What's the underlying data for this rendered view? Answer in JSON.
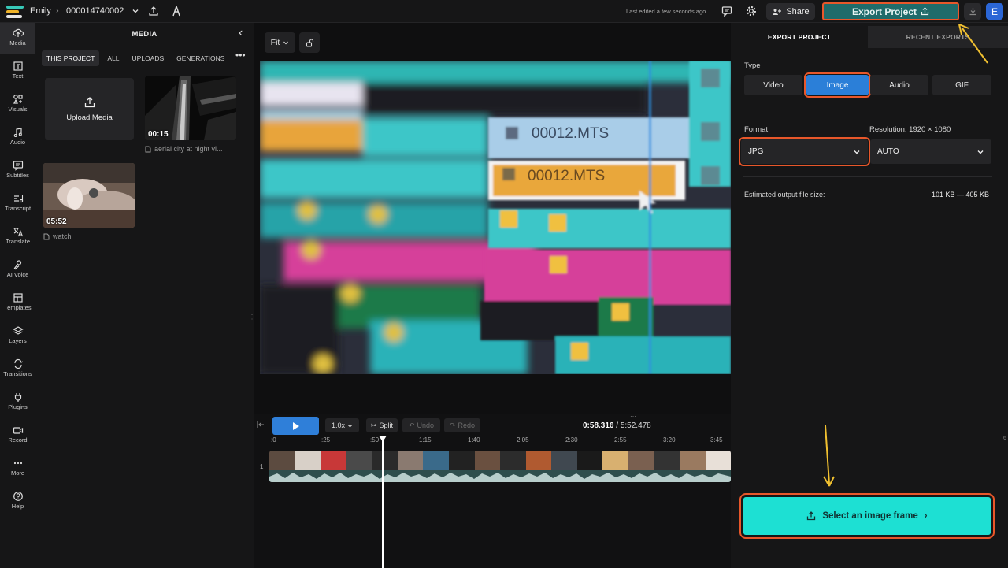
{
  "topbar": {
    "user_name": "Emily",
    "project_id": "000014740002",
    "last_edited": "Last edited a few seconds ago",
    "share_label": "Share",
    "export_label": "Export Project",
    "avatar_initial": "E"
  },
  "leftnav": {
    "items": [
      {
        "label": "Media",
        "icon": "upload-cloud-icon"
      },
      {
        "label": "Text",
        "icon": "text-icon"
      },
      {
        "label": "Visuals",
        "icon": "shapes-icon"
      },
      {
        "label": "Audio",
        "icon": "music-note-icon"
      },
      {
        "label": "Subtitles",
        "icon": "subtitles-icon"
      },
      {
        "label": "Transcript",
        "icon": "transcript-icon"
      },
      {
        "label": "Translate",
        "icon": "translate-icon"
      },
      {
        "label": "AI Voice",
        "icon": "voice-icon"
      },
      {
        "label": "Templates",
        "icon": "templates-icon"
      },
      {
        "label": "Layers",
        "icon": "layers-icon"
      },
      {
        "label": "Transitions",
        "icon": "transitions-icon"
      },
      {
        "label": "Plugins",
        "icon": "plug-icon"
      },
      {
        "label": "Record",
        "icon": "camera-icon"
      },
      {
        "label": "More",
        "icon": "ellipsis-icon"
      },
      {
        "label": "Help",
        "icon": "help-icon"
      }
    ]
  },
  "media": {
    "title": "MEDIA",
    "tabs": [
      "THIS PROJECT",
      "ALL",
      "UPLOADS",
      "GENERATIONS"
    ],
    "upload_label": "Upload Media",
    "items": [
      {
        "duration": "00:15",
        "caption": "aerial city at night vi..."
      },
      {
        "duration": "05:52",
        "caption": "watch"
      }
    ]
  },
  "stage": {
    "fit_label": "Fit",
    "preview_clip_labels": [
      "00012.MTS",
      "00012.MTS"
    ]
  },
  "timeline": {
    "speed": "1.0x",
    "split_label": "Split",
    "undo_label": "Undo",
    "redo_label": "Redo",
    "current_time": "0:58.316",
    "total_time": "/ 5:52.478",
    "ruler_ticks": [
      ":0",
      ":25",
      ":50",
      "1:15",
      "1:40",
      "2:05",
      "2:30",
      "2:55",
      "3:20",
      "3:45"
    ],
    "track_number": "1",
    "edge_tick": "6"
  },
  "export": {
    "tabs": [
      "EXPORT PROJECT",
      "RECENT EXPORTS"
    ],
    "type_label": "Type",
    "types": [
      "Video",
      "Image",
      "Audio",
      "GIF"
    ],
    "selected_type": "Image",
    "format_label": "Format",
    "format_value": "JPG",
    "resolution_label": "Resolution:  1920 × 1080",
    "resolution_value": "AUTO",
    "filesize_label": "Estimated output file size:",
    "filesize_value": "101 KB — 405 KB",
    "cta_label": "Select an image frame"
  },
  "colors": {
    "accent_blue": "#2b7fd8",
    "export_teal": "#1f6b6a",
    "cta_cyan": "#1de0d3",
    "highlight_orange": "#e8572a",
    "annotation_yellow": "#f0c030"
  }
}
